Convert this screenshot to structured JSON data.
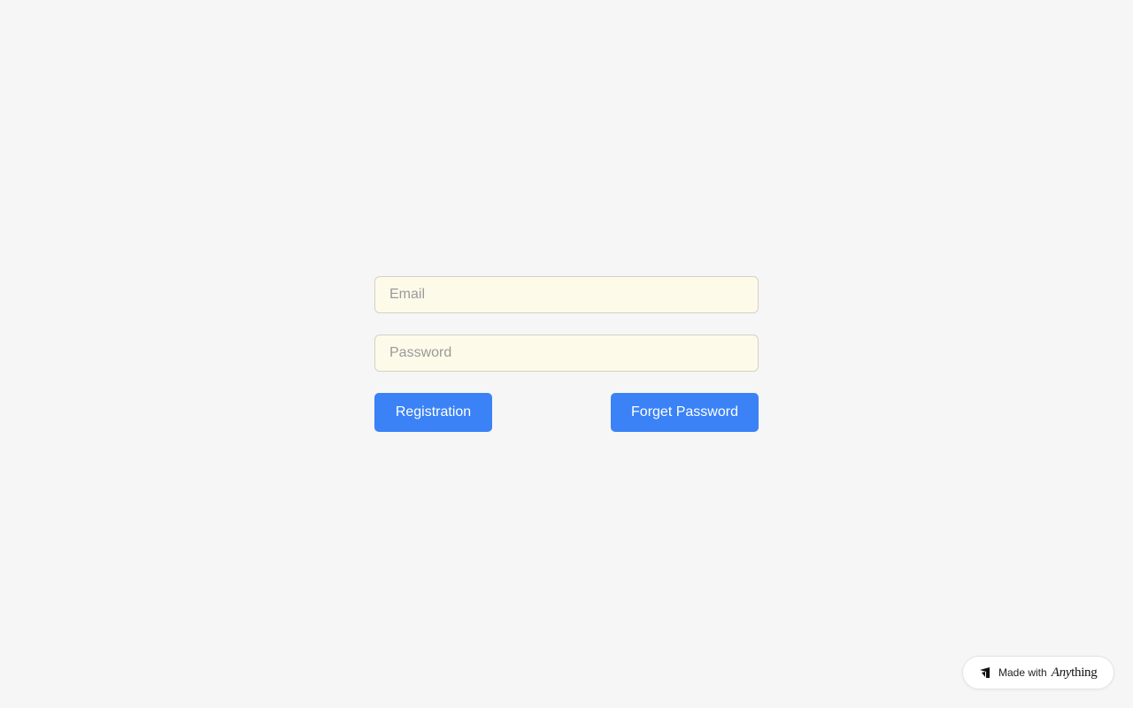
{
  "login_form": {
    "email": {
      "placeholder": "Email",
      "value": ""
    },
    "password": {
      "placeholder": "Password",
      "value": ""
    },
    "registration_label": "Registration",
    "forget_password_label": "Forget Password"
  },
  "badge": {
    "made_with": "Made with",
    "brand_italic": "Any",
    "brand_rest": "thing",
    "icon": "anything-logo-icon"
  },
  "colors": {
    "background": "#f6f6f6",
    "input_background": "#fefaea",
    "input_border": "#d4d1c7",
    "button_primary": "#3b82f6",
    "button_text": "#ffffff",
    "placeholder": "#9a9a9a"
  }
}
